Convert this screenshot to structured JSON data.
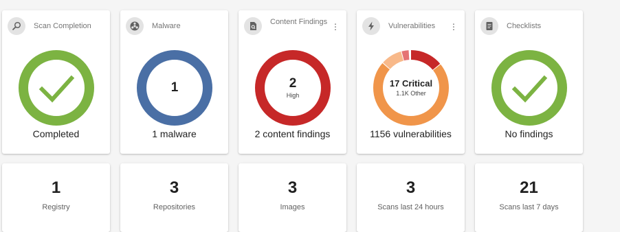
{
  "colors": {
    "green": "#7cb342",
    "blue": "#4a6fa5",
    "red": "#c62828",
    "orange": "#f0954a",
    "light_orange": "#f8b98a",
    "pink": "#e57373",
    "icon_bg": "#e3e3e3"
  },
  "cards": [
    {
      "title": "Scan Completion",
      "icon": "search-icon",
      "caption": "Completed",
      "progress": 1.0
    },
    {
      "title": "Malware",
      "icon": "biohazard-icon",
      "center_value": "1",
      "caption": "1 malware"
    },
    {
      "title": "Content Findings",
      "icon": "document-search-icon",
      "center_value": "2",
      "center_sub": "High",
      "caption": "2 content findings",
      "menu_icon": "more-vert-icon"
    },
    {
      "title": "Vulnerabilities",
      "icon": "lightning-icon",
      "center_value": "17 Critical",
      "center_sub": "1.1K Other",
      "caption": "1156 vulnerabilities",
      "menu_icon": "more-vert-icon"
    },
    {
      "title": "Checklists",
      "icon": "checklist-icon",
      "caption": "No findings",
      "progress": 1.0
    }
  ],
  "stats": [
    {
      "value": "1",
      "label": "Registry"
    },
    {
      "value": "3",
      "label": "Repositories"
    },
    {
      "value": "3",
      "label": "Images"
    },
    {
      "value": "3",
      "label": "Scans last 24 hours"
    },
    {
      "value": "21",
      "label": "Scans last 7 days"
    }
  ]
}
